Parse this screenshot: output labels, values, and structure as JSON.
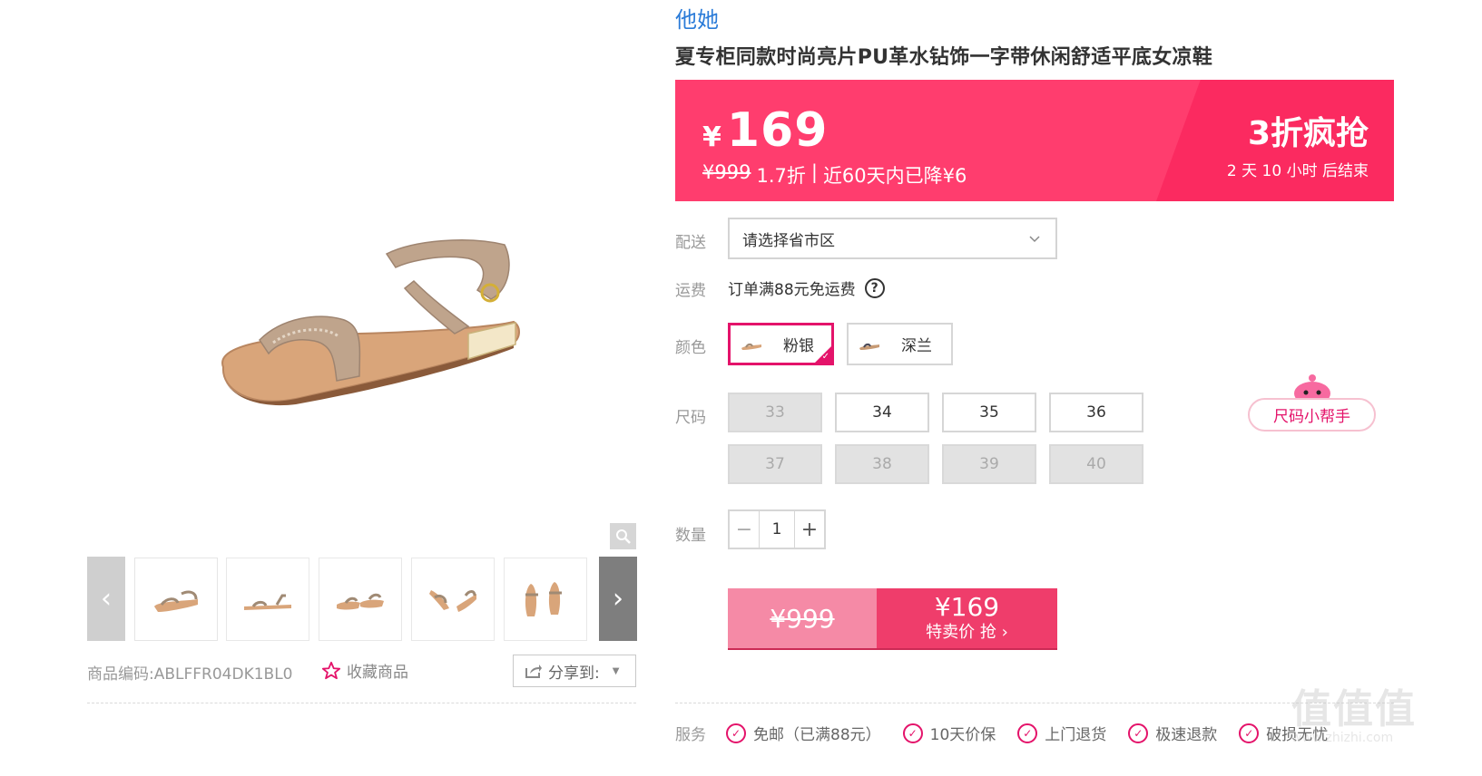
{
  "gallery": {
    "thumbnail_count": 5,
    "prev_glyph": "‹",
    "next_glyph": "›"
  },
  "product": {
    "brand": "他她",
    "title": "夏专柜同款时尚亮片PU革水钻饰一字带休闲舒适平底女凉鞋",
    "sku_label": "商品编码:",
    "sku_value": "ABLFFR04DK1BL0",
    "favorite_label": "收藏商品",
    "share_label": "分享到:"
  },
  "price": {
    "currency": "¥",
    "current": "169",
    "original": "¥999",
    "discount": "1.7折",
    "separator": "|",
    "drop_note": "近60天内已降¥6",
    "promo_title": "3折疯抢",
    "countdown": "2  天  10  小时  后结束"
  },
  "delivery": {
    "label": "配送",
    "placeholder": "请选择省市区"
  },
  "shipping": {
    "label": "运费",
    "text": "订单满88元免运费"
  },
  "color": {
    "label": "颜色",
    "options": [
      {
        "name": "粉银",
        "selected": true
      },
      {
        "name": "深兰",
        "selected": false
      }
    ]
  },
  "size": {
    "label": "尺码",
    "helper_label": "尺码小帮手",
    "options": [
      {
        "value": "33",
        "available": false
      },
      {
        "value": "34",
        "available": true
      },
      {
        "value": "35",
        "available": true
      },
      {
        "value": "36",
        "available": true
      },
      {
        "value": "37",
        "available": false
      },
      {
        "value": "38",
        "available": false
      },
      {
        "value": "39",
        "available": false
      },
      {
        "value": "40",
        "available": false
      }
    ]
  },
  "quantity": {
    "label": "数量",
    "value": "1",
    "minus": "−",
    "plus": "+"
  },
  "buy": {
    "original": "¥999",
    "price": "¥169",
    "label": "特卖价 抢 ›"
  },
  "services": {
    "label": "服务",
    "items": [
      "免邮（已满88元）",
      "10天价保",
      "上门退货",
      "极速退款",
      "破损无忧"
    ]
  },
  "watermark": {
    "glyphs": "值值值",
    "url": "www.zhizhi.com"
  },
  "colors": {
    "accent": "#ff3d6e",
    "brand_link": "#2a7bd8",
    "selected_border": "#e4136a"
  }
}
